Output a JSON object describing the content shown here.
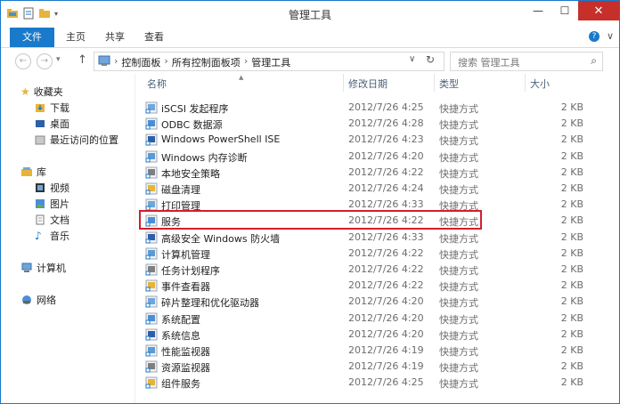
{
  "window": {
    "title": "管理工具",
    "controls": {
      "minimize": "—",
      "maximize": "☐",
      "close": "✕"
    }
  },
  "ribbon": {
    "file": "文件",
    "home": "主页",
    "share": "共享",
    "view": "查看",
    "toggle": "∨",
    "help": "?"
  },
  "address": {
    "crumbs": [
      "控制面板",
      "所有控制面板项",
      "管理工具"
    ],
    "separator": "›",
    "search_placeholder": "搜索 管理工具"
  },
  "nav": {
    "favorites": {
      "label": "收藏夹",
      "items": [
        "下载",
        "桌面",
        "最近访问的位置"
      ]
    },
    "libraries": {
      "label": "库",
      "items": [
        "视频",
        "图片",
        "文档",
        "音乐"
      ]
    },
    "computer": "计算机",
    "network": "网络"
  },
  "columns": {
    "name": "名称",
    "date": "修改日期",
    "type": "类型",
    "size": "大小"
  },
  "files": [
    {
      "name": "iSCSI 发起程序",
      "date": "2012/7/26 4:25",
      "type": "快捷方式",
      "size": "2 KB"
    },
    {
      "name": "ODBC 数据源",
      "date": "2012/7/26 4:28",
      "type": "快捷方式",
      "size": "2 KB"
    },
    {
      "name": "Windows PowerShell ISE",
      "date": "2012/7/26 4:23",
      "type": "快捷方式",
      "size": "2 KB"
    },
    {
      "name": "Windows 内存诊断",
      "date": "2012/7/26 4:20",
      "type": "快捷方式",
      "size": "2 KB"
    },
    {
      "name": "本地安全策略",
      "date": "2012/7/26 4:22",
      "type": "快捷方式",
      "size": "2 KB"
    },
    {
      "name": "磁盘清理",
      "date": "2012/7/26 4:24",
      "type": "快捷方式",
      "size": "2 KB"
    },
    {
      "name": "打印管理",
      "date": "2012/7/26 4:33",
      "type": "快捷方式",
      "size": "2 KB"
    },
    {
      "name": "服务",
      "date": "2012/7/26 4:22",
      "type": "快捷方式",
      "size": "2 KB"
    },
    {
      "name": "高级安全 Windows 防火墙",
      "date": "2012/7/26 4:33",
      "type": "快捷方式",
      "size": "2 KB"
    },
    {
      "name": "计算机管理",
      "date": "2012/7/26 4:22",
      "type": "快捷方式",
      "size": "2 KB"
    },
    {
      "name": "任务计划程序",
      "date": "2012/7/26 4:22",
      "type": "快捷方式",
      "size": "2 KB"
    },
    {
      "name": "事件查看器",
      "date": "2012/7/26 4:22",
      "type": "快捷方式",
      "size": "2 KB"
    },
    {
      "name": "碎片整理和优化驱动器",
      "date": "2012/7/26 4:20",
      "type": "快捷方式",
      "size": "2 KB"
    },
    {
      "name": "系统配置",
      "date": "2012/7/26 4:20",
      "type": "快捷方式",
      "size": "2 KB"
    },
    {
      "name": "系统信息",
      "date": "2012/7/26 4:20",
      "type": "快捷方式",
      "size": "2 KB"
    },
    {
      "name": "性能监视器",
      "date": "2012/7/26 4:19",
      "type": "快捷方式",
      "size": "2 KB"
    },
    {
      "name": "资源监视器",
      "date": "2012/7/26 4:19",
      "type": "快捷方式",
      "size": "2 KB"
    },
    {
      "name": "组件服务",
      "date": "2012/7/26 4:25",
      "type": "快捷方式",
      "size": "2 KB"
    }
  ],
  "colors": {
    "accent": "#1979ca",
    "highlight": "#d21f2b",
    "close": "#c7302a"
  }
}
